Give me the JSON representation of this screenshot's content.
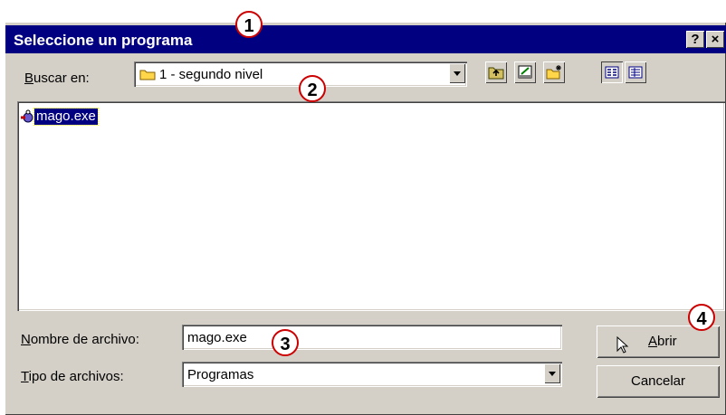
{
  "dialog": {
    "title": "Seleccione un programa",
    "help_button": "?",
    "close_button": "×"
  },
  "look_in": {
    "label_accel": "B",
    "label_rest": "uscar en:",
    "value": "1 - segundo nivel"
  },
  "file_list": {
    "items": [
      {
        "name": "mago.exe",
        "icon": "executable-icon",
        "selected": true
      }
    ]
  },
  "file_name": {
    "label_accel": "N",
    "label_rest": "ombre de archivo:",
    "value": "mago.exe"
  },
  "file_type": {
    "label_accel": "T",
    "label_rest": "ipo de archivos:",
    "value": "Programas"
  },
  "buttons": {
    "open_accel": "A",
    "open_rest": "brir",
    "cancel": "Cancelar"
  },
  "toolbar_icons": [
    "up-one-level-icon",
    "desktop-icon",
    "new-folder-icon",
    "list-view-icon",
    "details-view-icon"
  ],
  "callouts": [
    "1",
    "2",
    "3",
    "4"
  ],
  "colors": {
    "titlebar": "#000080",
    "selection": "#000080",
    "callout_border": "#cc0000"
  }
}
